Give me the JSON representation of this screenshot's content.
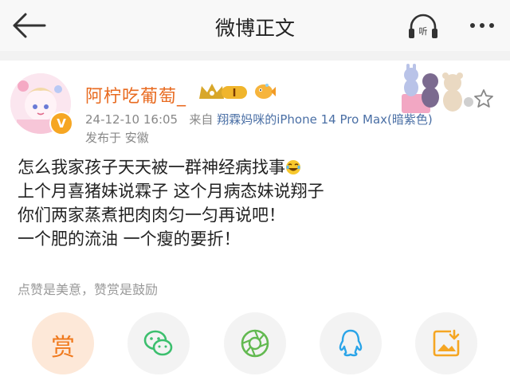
{
  "header": {
    "title": "微博正文",
    "listen_label": "听"
  },
  "post": {
    "username": "阿柠吃葡萄_",
    "level_badge": "I",
    "verified_badge": "V",
    "timestamp": "24-12-10 16:05",
    "source_prefix": "来自",
    "source": "翔霖妈咪的iPhone 14 Pro Max(暗紫色)",
    "location": "发布于 安徽",
    "lines": [
      "怎么我家孩子天天被一群神经病找事",
      "上个月喜猪妹说霖子 这个月病态妹说翔子",
      "你们两家蒸煮把肉肉匀一匀再说吧！",
      "一个肥的流油 一个瘦的要折！"
    ]
  },
  "reward": {
    "tip": "点赞是美意，赞赏是鼓励",
    "button_label": "赏"
  },
  "share": [
    {
      "name": "wechat-icon",
      "color": "#3cbf6e"
    },
    {
      "name": "moments-icon",
      "color": "#62b950"
    },
    {
      "name": "qq-icon",
      "color": "#2aa4e8"
    },
    {
      "name": "save-image-icon",
      "color": "#f5a623"
    }
  ],
  "colors": {
    "accent": "#e86a1f",
    "link": "#4a6fa5",
    "reward_bg": "#fde8d8"
  }
}
